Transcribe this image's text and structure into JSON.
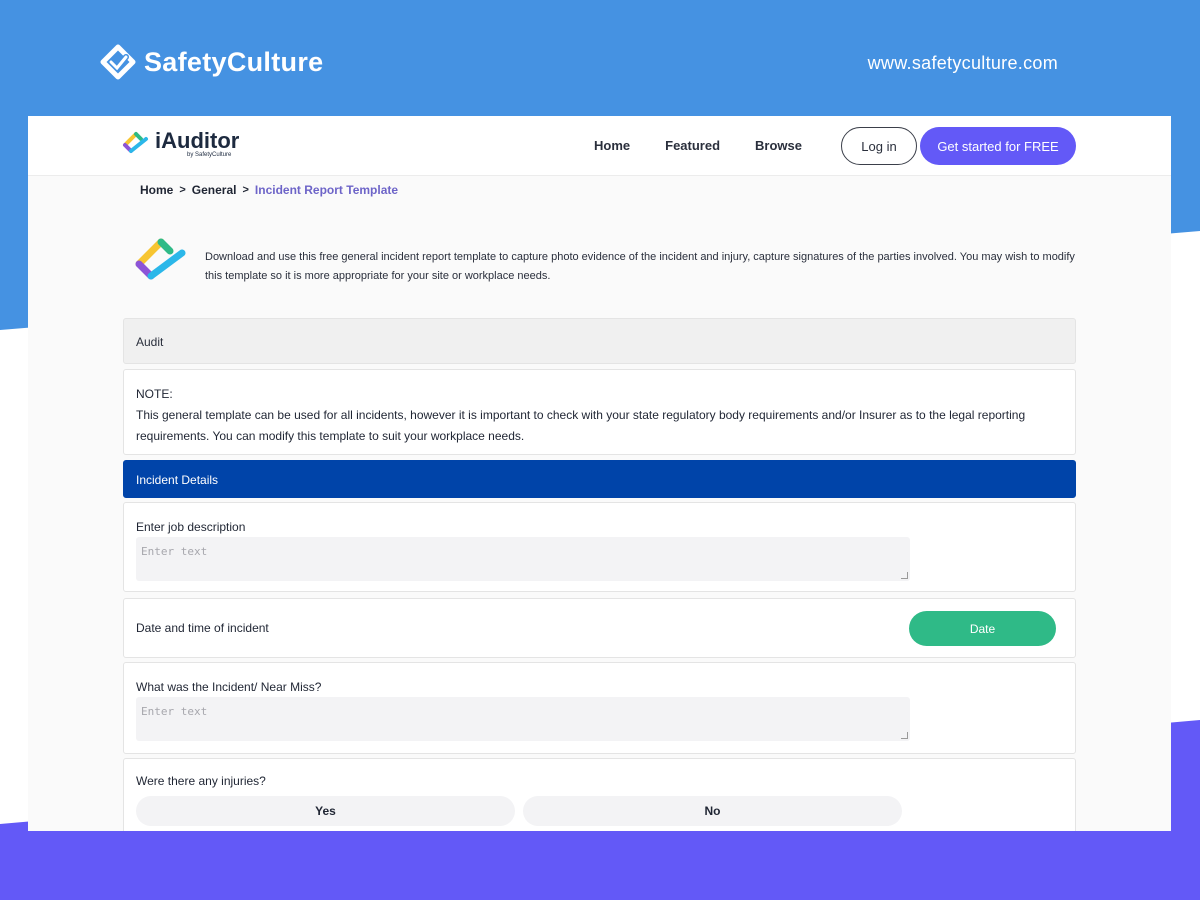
{
  "brand": {
    "name": "SafetyCulture",
    "url": "www.safetyculture.com"
  },
  "nav": {
    "app_name": "iAuditor",
    "app_sub": "by SafetyCulture",
    "links": [
      "Home",
      "Featured",
      "Browse"
    ],
    "login_label": "Log in",
    "cta_label": "Get started for FREE"
  },
  "breadcrumb": {
    "items": [
      "Home",
      "General"
    ],
    "current": "Incident Report Template",
    "separator": ">"
  },
  "intro": {
    "text": "Download and use this free general incident report template to capture photo evidence of the incident and injury, capture signatures of the parties involved. You may wish to modify this template so it is more appropriate for your site or workplace needs."
  },
  "audit": {
    "label": "Audit"
  },
  "note": {
    "title": "NOTE:",
    "body": "This general template can be used for all incidents, however it is important to check with your state regulatory body requirements and/or Insurer as to the legal reporting requirements. You can modify this template to suit your workplace needs."
  },
  "details": {
    "label": "Incident Details"
  },
  "fields": {
    "job_description": {
      "label": "Enter job description",
      "placeholder": "Enter text"
    },
    "date_time": {
      "label": "Date and time of incident",
      "button_label": "Date"
    },
    "incident": {
      "label": "What was the Incident/ Near Miss?",
      "placeholder": "Enter text"
    },
    "injuries": {
      "label": "Were there any injuries?",
      "options": [
        "Yes",
        "No"
      ]
    }
  },
  "colors": {
    "top_background": "#4592e2",
    "bottom_background": "#6359f7",
    "cta": "#6359f7",
    "section_header": "#0044a9",
    "date_button": "#2fba87",
    "breadcrumb_current": "#6d64c8"
  }
}
